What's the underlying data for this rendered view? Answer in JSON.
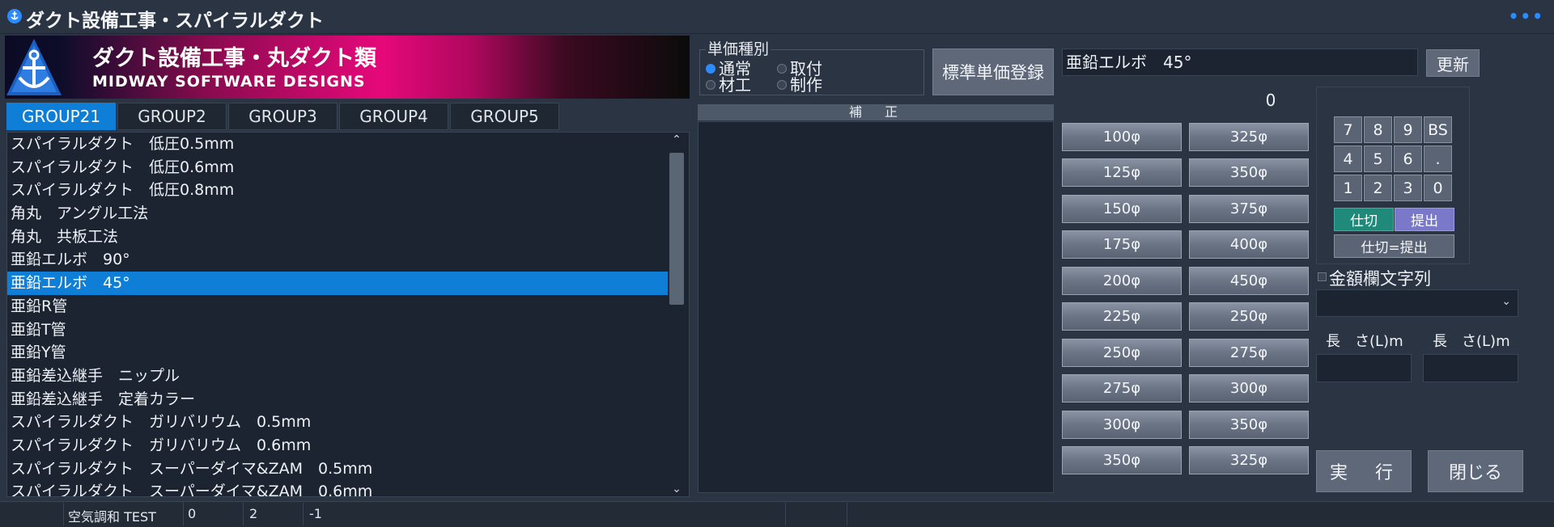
{
  "window": {
    "title": "ダクト設備工事・スパイラルダクト"
  },
  "banner": {
    "title": "ダクト設備工事・丸ダクト類",
    "subtitle": "MIDWAY SOFTWARE DESIGNS"
  },
  "tabs": [
    {
      "label": "GROUP21",
      "active": true
    },
    {
      "label": "GROUP2",
      "active": false
    },
    {
      "label": "GROUP3",
      "active": false
    },
    {
      "label": "GROUP4",
      "active": false
    },
    {
      "label": "GROUP5",
      "active": false
    }
  ],
  "list": {
    "items": [
      "スパイラルダクト　低圧0.5mm",
      "スパイラルダクト　低圧0.6mm",
      "スパイラルダクト　低圧0.8mm",
      "角丸　アングル工法",
      "角丸　共板工法",
      "亜鉛エルボ　90°",
      "亜鉛エルボ　45°",
      "亜鉛R管",
      "亜鉛T管",
      "亜鉛Y管",
      "亜鉛差込継手　ニップル",
      "亜鉛差込継手　定着カラー",
      "スパイラルダクト　ガリバリウム　0.5mm",
      "スパイラルダクト　ガリバリウム　0.6mm",
      "スパイラルダクト　スーパーダイマ&ZAM　0.5mm",
      "スパイラルダクト　スーパーダイマ&ZAM　0.6mm"
    ],
    "selected_index": 6
  },
  "price_type": {
    "label": "単価種別",
    "options": [
      "通常",
      "取付",
      "材工",
      "制作"
    ],
    "selected": "通常"
  },
  "std_price_button": "標準単価登録",
  "correction": {
    "header": "補　正"
  },
  "selected_item": {
    "value": "亜鉛エルボ　45°",
    "update_label": "更新"
  },
  "count": "0",
  "sizes": {
    "col1": [
      "100φ",
      "125φ",
      "150φ",
      "175φ",
      "200φ",
      "225φ",
      "250φ",
      "275φ",
      "300φ",
      "350φ"
    ],
    "col2": [
      "325φ",
      "350φ",
      "375φ",
      "400φ",
      "450φ",
      "250φ",
      "275φ",
      "300φ",
      "350φ",
      "325φ"
    ]
  },
  "keypad": {
    "rows": [
      [
        "7",
        "8",
        "9",
        "BS"
      ],
      [
        "4",
        "5",
        "6",
        "."
      ],
      [
        "1",
        "2",
        "3",
        "0"
      ]
    ],
    "shikiri": "仕切",
    "teishutsu": "提出",
    "shikiri_eq": "仕切=提出"
  },
  "amount": {
    "label": "金額欄文字列"
  },
  "length": {
    "label1": "長　さ(L)m",
    "label2": "長　さ(L)m"
  },
  "actions": {
    "execute": "実　行",
    "close": "閉じる"
  },
  "status": {
    "cells": [
      "空気調和 TEST",
      "0",
      "2",
      "-1"
    ]
  },
  "colors": {
    "accent": "#0f7ed6",
    "banner_pink": "#e6087a",
    "shikiri": "#1f8a7a",
    "teishutsu": "#7a78c8"
  }
}
